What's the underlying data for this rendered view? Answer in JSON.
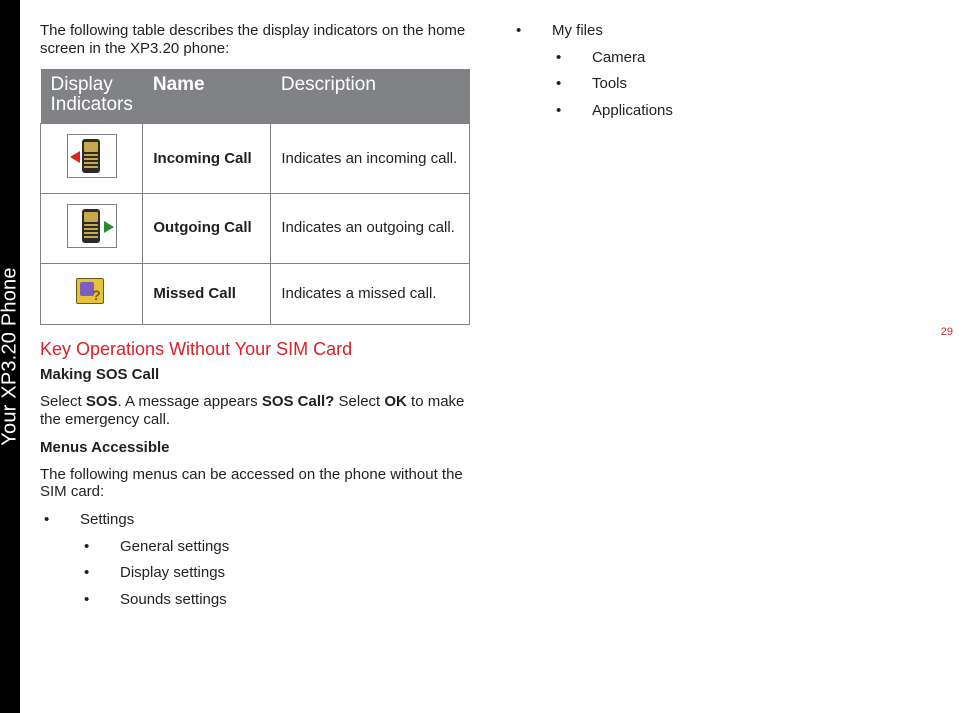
{
  "sidebar": {
    "label": "Your XP3.20 Phone"
  },
  "page_number": "29",
  "left": {
    "intro": "The following table describes the display indicators on the home screen in the XP3.20 phone:",
    "table": {
      "head": [
        "Display Indicators",
        "Name",
        "Description"
      ],
      "rows": [
        {
          "icon": "incoming",
          "name": "Incoming Call",
          "desc": "Indicates an incoming call."
        },
        {
          "icon": "outgoing",
          "name": "Outgoing Call",
          "desc": "Indicates an outgoing call."
        },
        {
          "icon": "missed",
          "name": "Missed Call",
          "desc": "Indicates a missed call."
        }
      ]
    },
    "red_heading": "Key Operations Without Your SIM Card",
    "sos_head": "Making SOS Call",
    "sos_p1a": "Select ",
    "sos_p1b": "SOS",
    "sos_p1c": ". A message appears ",
    "sos_p1d": "SOS Call?",
    "sos_p1e": " Select ",
    "sos_p1f": "OK",
    "sos_p1g": " to make the emergency call.",
    "menus_head": "Menus Accessible",
    "menus_intro": "The following menus can be accessed on the phone without the SIM card:",
    "list_left": {
      "item": "Settings",
      "subs": [
        "General settings",
        "Display settings",
        "Sounds settings"
      ]
    }
  },
  "right": {
    "list": {
      "item": "My files",
      "subs": [
        "Camera",
        "Tools",
        "Applications"
      ]
    }
  }
}
